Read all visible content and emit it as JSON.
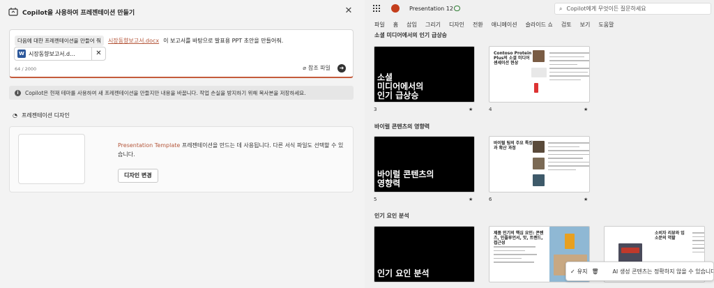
{
  "copilot": {
    "title": "Copilot을 사용하여 프레젠테이션 만들기",
    "prompt_chip": "다음에 대한 프레젠테이션을 만들어 줘",
    "file_link": "시장동향보고서.docx",
    "prompt_rest": "이 보고서를 바탕으로 발표용 PPT 초안을 만들어줘.",
    "file_chip_name": "시장동향보고서.d...",
    "char_count": "64 / 2000",
    "ref_file_label": "참조 파일",
    "info_text": "Copilot은 현재 테마를 사용하여 새 프레젠테이션을 만들지만 내용을 바꿉니다. 작업 손실을 방지하기 위해 복사본을 저장하세요.",
    "design_section_label": "프레젠테이션 디자인",
    "template_name": "Presentation Template",
    "template_desc": " 프레젠테이션을 만드는 데 사용됩니다. 다른 서식 파일도 선택할 수 있습니다.",
    "change_design_label": "디자인 변경"
  },
  "ppt": {
    "title": "Presentation 12",
    "search_placeholder": "Copilot에게 무엇이든 질문하세요",
    "ribbon_tabs": [
      "파일",
      "홈",
      "삽입",
      "그리기",
      "디자인",
      "전환",
      "애니메이션",
      "슬라이드 쇼",
      "검토",
      "보기",
      "도움말"
    ],
    "sections": [
      {
        "title": "소셜 미디어에서의 인기 급상승"
      },
      {
        "title": "바이럴 콘텐츠의 영향력"
      },
      {
        "title": "인기 요인 분석"
      }
    ],
    "slides": [
      {
        "num": "3",
        "text": "소셜\n미디어에서의\n인기 급상승"
      },
      {
        "num": "4",
        "title": "Contoso Protein Plus의 소셜 미디어 센세이션 현상"
      },
      {
        "num": "5",
        "text": "바이럴 콘텐츠의\n영향력"
      },
      {
        "num": "6",
        "title": "바이럴 팀의 주요 특징과 확산 과정"
      },
      {
        "text": "인기 요인 분석"
      },
      {
        "title": "제품 인기의 핵심 요인: 콘텐츠, 인플루언서, 맛, 트렌드, 접근성"
      },
      {
        "title": "소비자 리뷰와 입소문의 역할"
      }
    ],
    "star": "★"
  },
  "toast": {
    "keep_label": "유지",
    "warning": "AI 생성 콘텐츠는 정확하지 않을 수 있습니다"
  }
}
